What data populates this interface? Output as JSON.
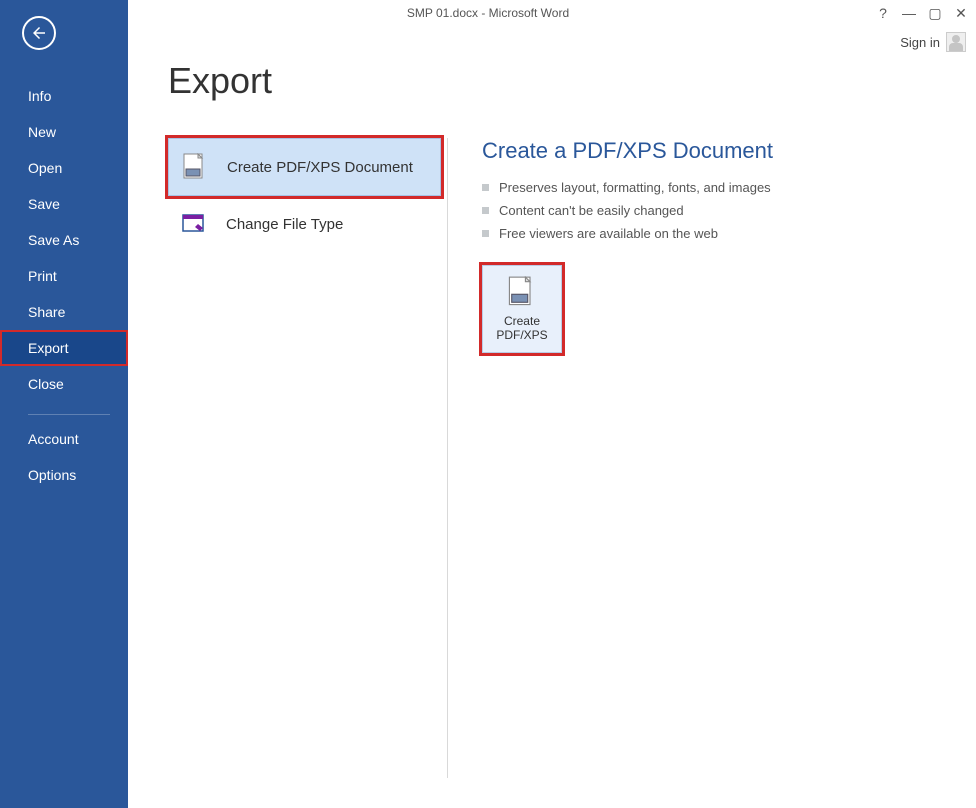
{
  "window": {
    "title": "SMP 01.docx - Microsoft Word",
    "help_glyph": "?",
    "minimize_glyph": "—",
    "maximize_glyph": "▢",
    "close_glyph": "✕"
  },
  "signin": {
    "label": "Sign in"
  },
  "sidebar": {
    "items": [
      {
        "label": "Info"
      },
      {
        "label": "New"
      },
      {
        "label": "Open"
      },
      {
        "label": "Save"
      },
      {
        "label": "Save As"
      },
      {
        "label": "Print"
      },
      {
        "label": "Share"
      },
      {
        "label": "Export",
        "selected": true
      },
      {
        "label": "Close"
      }
    ],
    "footer": [
      {
        "label": "Account"
      },
      {
        "label": "Options"
      }
    ]
  },
  "page": {
    "title": "Export"
  },
  "export_options": [
    {
      "label": "Create PDF/XPS Document",
      "selected": true
    },
    {
      "label": "Change File Type"
    }
  ],
  "right_panel": {
    "title": "Create a PDF/XPS Document",
    "bullets": [
      "Preserves layout, formatting, fonts, and images",
      "Content can't be easily changed",
      "Free viewers are available on the web"
    ],
    "create_button_label": "Create\nPDF/XPS"
  }
}
